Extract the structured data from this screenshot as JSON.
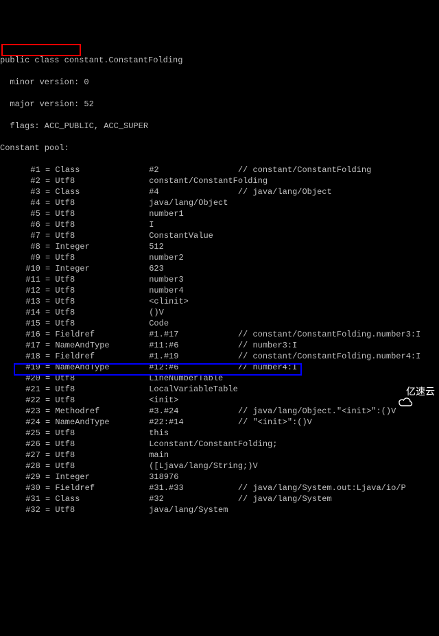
{
  "header": {
    "class_decl": "public class constant.ConstantFolding",
    "minor": "  minor version: 0",
    "major": "  major version: 52",
    "flags": "  flags: ACC_PUBLIC, ACC_SUPER",
    "pool_label": "Constant pool:"
  },
  "pool": [
    {
      "idx": "#1",
      "eq": " = ",
      "type": "Class",
      "ref": "#2",
      "cmt": "// constant/ConstantFolding"
    },
    {
      "idx": "#2",
      "eq": " = ",
      "type": "Utf8",
      "ref": "constant/ConstantFolding",
      "cmt": ""
    },
    {
      "idx": "#3",
      "eq": " = ",
      "type": "Class",
      "ref": "#4",
      "cmt": "// java/lang/Object"
    },
    {
      "idx": "#4",
      "eq": " = ",
      "type": "Utf8",
      "ref": "java/lang/Object",
      "cmt": ""
    },
    {
      "idx": "#5",
      "eq": " = ",
      "type": "Utf8",
      "ref": "number1",
      "cmt": ""
    },
    {
      "idx": "#6",
      "eq": " = ",
      "type": "Utf8",
      "ref": "I",
      "cmt": ""
    },
    {
      "idx": "#7",
      "eq": " = ",
      "type": "Utf8",
      "ref": "ConstantValue",
      "cmt": ""
    },
    {
      "idx": "#8",
      "eq": " = ",
      "type": "Integer",
      "ref": "512",
      "cmt": ""
    },
    {
      "idx": "#9",
      "eq": " = ",
      "type": "Utf8",
      "ref": "number2",
      "cmt": ""
    },
    {
      "idx": "#10",
      "eq": " = ",
      "type": "Integer",
      "ref": "623",
      "cmt": ""
    },
    {
      "idx": "#11",
      "eq": " = ",
      "type": "Utf8",
      "ref": "number3",
      "cmt": ""
    },
    {
      "idx": "#12",
      "eq": " = ",
      "type": "Utf8",
      "ref": "number4",
      "cmt": ""
    },
    {
      "idx": "#13",
      "eq": " = ",
      "type": "Utf8",
      "ref": "<clinit>",
      "cmt": ""
    },
    {
      "idx": "#14",
      "eq": " = ",
      "type": "Utf8",
      "ref": "()V",
      "cmt": ""
    },
    {
      "idx": "#15",
      "eq": " = ",
      "type": "Utf8",
      "ref": "Code",
      "cmt": ""
    },
    {
      "idx": "#16",
      "eq": " = ",
      "type": "Fieldref",
      "ref": "#1.#17",
      "cmt": "// constant/ConstantFolding.number3:I"
    },
    {
      "idx": "#17",
      "eq": " = ",
      "type": "NameAndType",
      "ref": "#11:#6",
      "cmt": "// number3:I"
    },
    {
      "idx": "#18",
      "eq": " = ",
      "type": "Fieldref",
      "ref": "#1.#19",
      "cmt": "// constant/ConstantFolding.number4:I"
    },
    {
      "idx": "#19",
      "eq": " = ",
      "type": "NameAndType",
      "ref": "#12:#6",
      "cmt": "// number4:I"
    },
    {
      "idx": "#20",
      "eq": " = ",
      "type": "Utf8",
      "ref": "LineNumberTable",
      "cmt": ""
    },
    {
      "idx": "#21",
      "eq": " = ",
      "type": "Utf8",
      "ref": "LocalVariableTable",
      "cmt": ""
    },
    {
      "idx": "#22",
      "eq": " = ",
      "type": "Utf8",
      "ref": "<init>",
      "cmt": ""
    },
    {
      "idx": "#23",
      "eq": " = ",
      "type": "Methodref",
      "ref": "#3.#24",
      "cmt": "// java/lang/Object.\"<init>\":()V"
    },
    {
      "idx": "#24",
      "eq": " = ",
      "type": "NameAndType",
      "ref": "#22:#14",
      "cmt": "// \"<init>\":()V"
    },
    {
      "idx": "#25",
      "eq": " = ",
      "type": "Utf8",
      "ref": "this",
      "cmt": ""
    },
    {
      "idx": "#26",
      "eq": " = ",
      "type": "Utf8",
      "ref": "Lconstant/ConstantFolding;",
      "cmt": ""
    },
    {
      "idx": "#27",
      "eq": " = ",
      "type": "Utf8",
      "ref": "main",
      "cmt": ""
    },
    {
      "idx": "#28",
      "eq": " = ",
      "type": "Utf8",
      "ref": "([Ljava/lang/String;)V",
      "cmt": ""
    },
    {
      "idx": "#29",
      "eq": " = ",
      "type": "Integer",
      "ref": "318976",
      "cmt": ""
    },
    {
      "idx": "#30",
      "eq": " = ",
      "type": "Fieldref",
      "ref": "#31.#33",
      "cmt": "// java/lang/System.out:Ljava/io/P"
    },
    {
      "idx": "#31",
      "eq": " = ",
      "type": "Class",
      "ref": "#32",
      "cmt": "// java/lang/System"
    },
    {
      "idx": "#32",
      "eq": " = ",
      "type": "Utf8",
      "ref": "java/lang/System",
      "cmt": ""
    }
  ],
  "watermark": {
    "text": "亿速云"
  }
}
